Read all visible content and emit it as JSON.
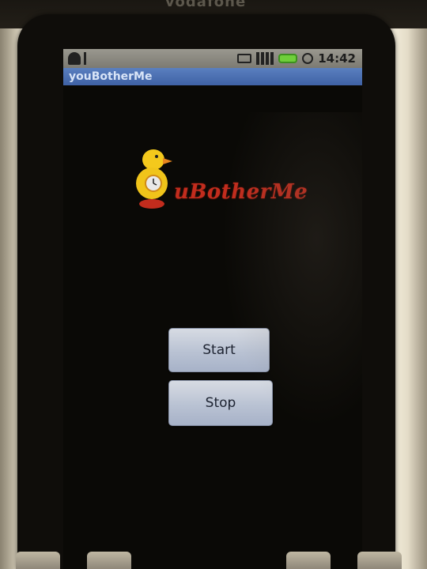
{
  "device": {
    "carrier_label": "vodafone"
  },
  "status_bar": {
    "time": "14:42",
    "left_icons": [
      "android-icon",
      "usb-icon"
    ],
    "right_icons": [
      "battery-indicator-icon",
      "signal-icon",
      "battery-icon",
      "alarm-clock-icon"
    ],
    "battery_color": "#6fcf3a"
  },
  "app": {
    "title": "youBotherMe",
    "title_bar_color": "#4a6db0",
    "logo": {
      "text": "uBotherMe",
      "text_color": "#c22c1d",
      "icon": "duck-clock-icon"
    }
  },
  "buttons": {
    "start_label": "Start",
    "stop_label": "Stop"
  }
}
